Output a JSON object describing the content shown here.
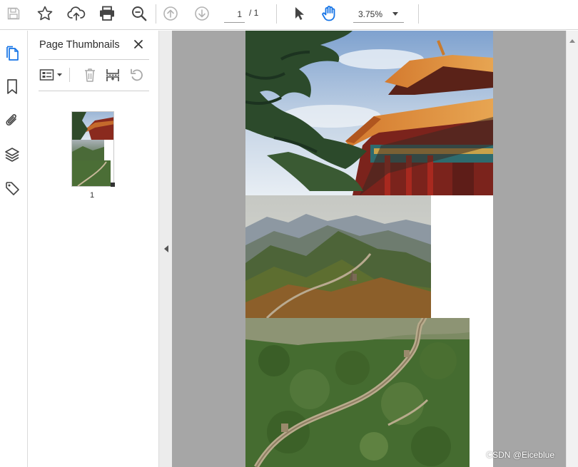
{
  "toolbar": {
    "page_current": "1",
    "page_total": "/ 1",
    "zoom": "3.75%",
    "icons": [
      "save-icon",
      "star-icon",
      "cloud-upload-icon",
      "print-icon",
      "zoom-search-icon",
      "page-up-icon",
      "page-down-icon",
      "select-pointer-icon",
      "hand-tool-icon",
      "dropdown-caret-icon"
    ]
  },
  "rail": {
    "icons": [
      "page-thumbnails-icon",
      "bookmark-icon",
      "attachment-icon",
      "layers-icon",
      "tags-icon"
    ]
  },
  "panel": {
    "title": "Page Thumbnails",
    "tools": [
      "thumbnail-options-icon",
      "delete-icon",
      "insert-page-icon",
      "rotate-icon"
    ],
    "thumbnail_label": "1"
  },
  "document": {
    "images": [
      "forbidden-city-roof",
      "mountain-great-wall",
      "great-wall-forest"
    ]
  },
  "watermark": "CSDN @Eiceblue",
  "colors": {
    "accent": "#1473e6",
    "doc_background": "#a6a6a6"
  }
}
